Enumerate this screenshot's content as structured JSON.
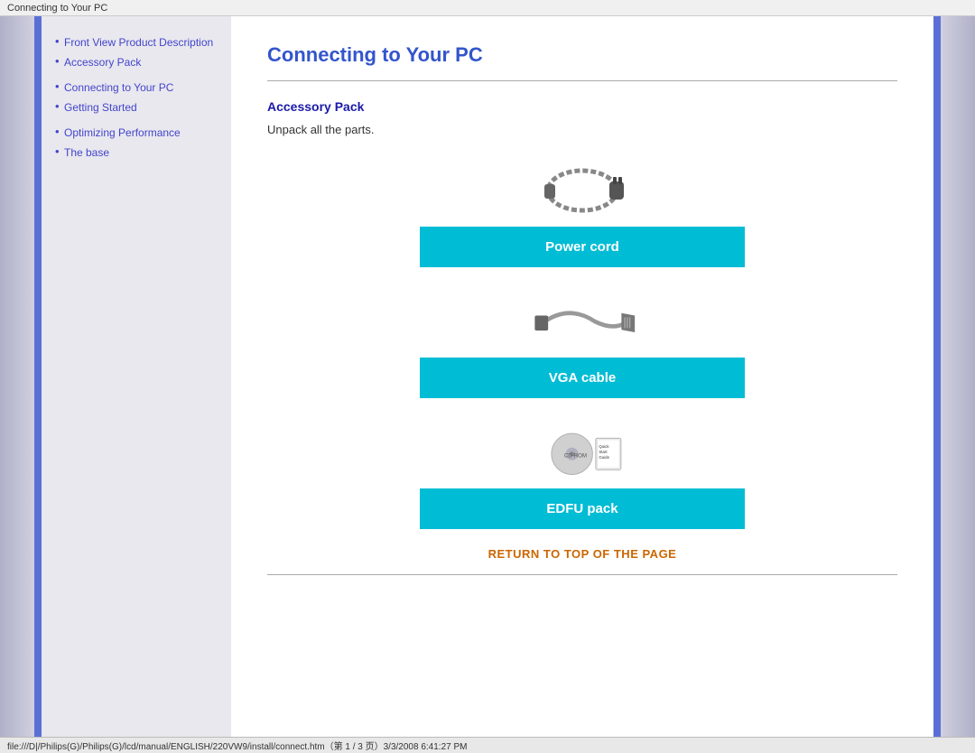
{
  "titlebar": {
    "text": "Connecting to Your PC"
  },
  "sidebar": {
    "groups": [
      {
        "items": [
          {
            "label": "Front View Product Description",
            "href": "#"
          },
          {
            "label": "Accessory Pack",
            "href": "#"
          }
        ]
      },
      {
        "items": [
          {
            "label": "Connecting to Your PC",
            "href": "#"
          },
          {
            "label": "Getting Started",
            "href": "#"
          }
        ]
      },
      {
        "items": [
          {
            "label": "Optimizing Performance",
            "href": "#"
          },
          {
            "label": "The base",
            "href": "#"
          }
        ]
      }
    ]
  },
  "main": {
    "title": "Connecting to Your PC",
    "section_heading": "Accessory Pack",
    "intro": "Unpack all the parts.",
    "accessories": [
      {
        "label": "Power cord"
      },
      {
        "label": "VGA cable"
      },
      {
        "label": "EDFU pack"
      }
    ],
    "return_link": "RETURN TO TOP OF THE PAGE"
  },
  "statusbar": {
    "text": "file:///D|/Philips(G)/Philips(G)/lcd/manual/ENGLISH/220VW9/install/connect.htm（第 1 / 3 页）3/3/2008 6:41:27 PM"
  }
}
